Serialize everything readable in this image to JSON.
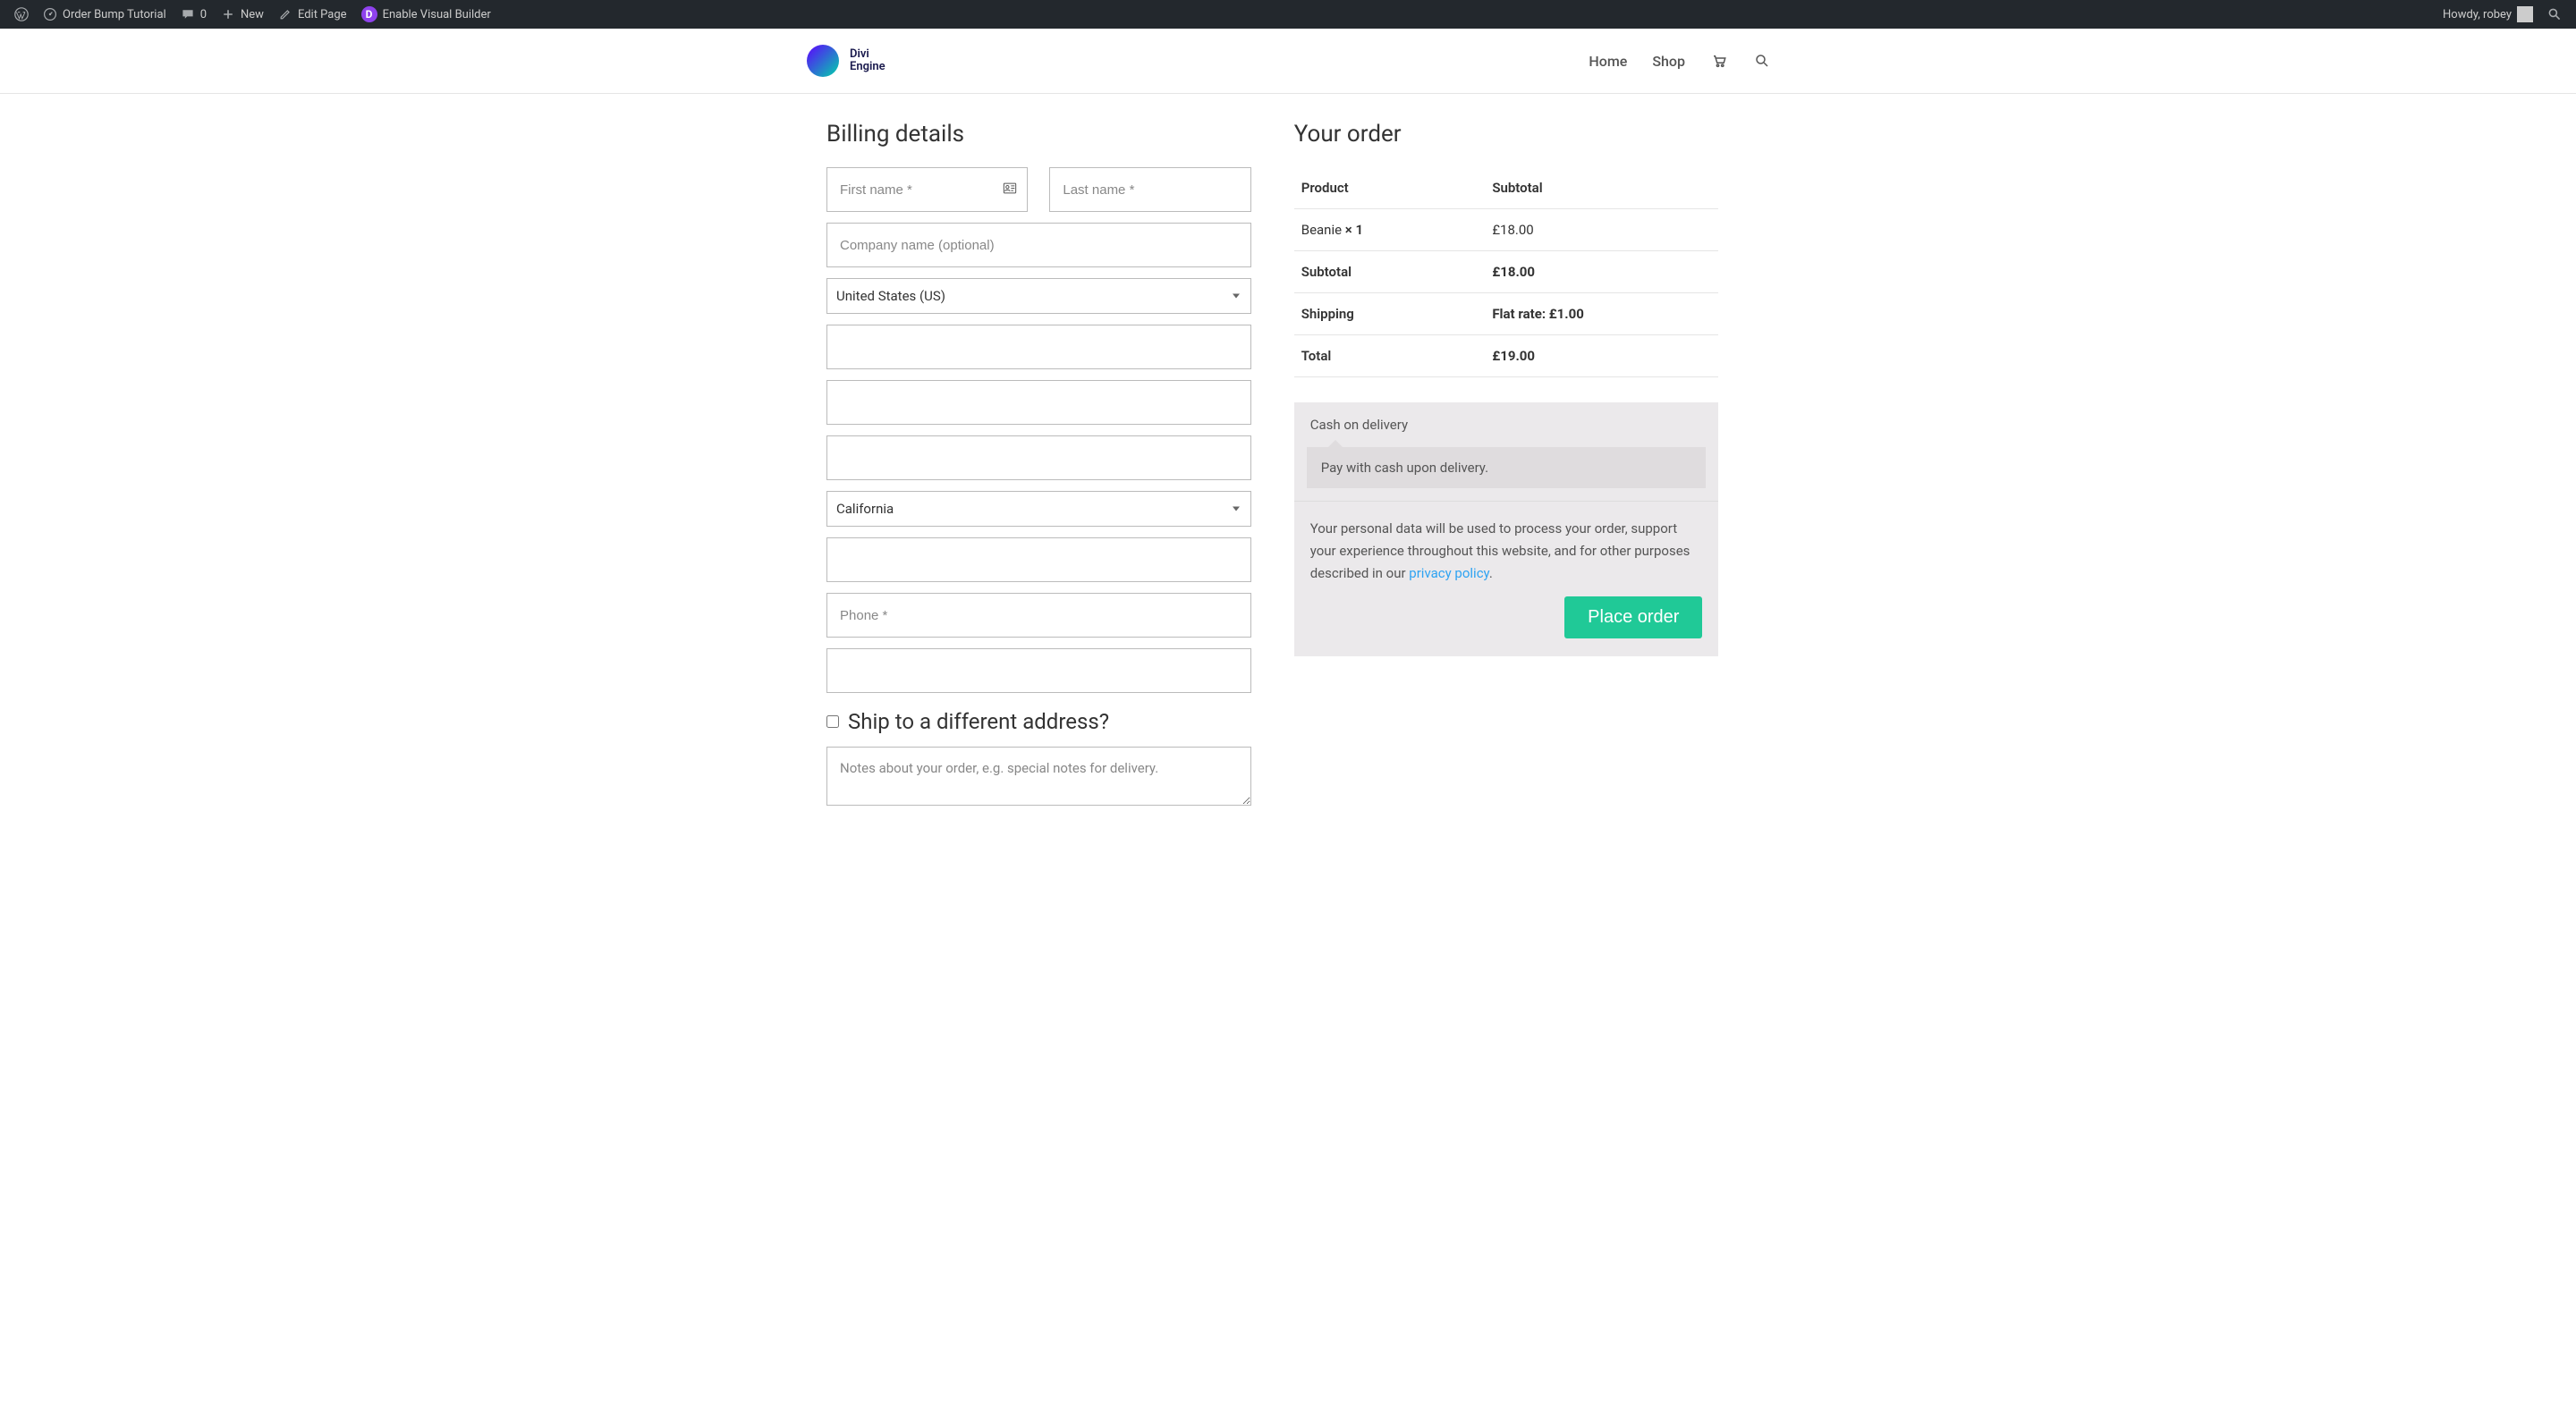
{
  "adminbar": {
    "site_title": "Order Bump Tutorial",
    "comments_count": "0",
    "new_label": "New",
    "edit_label": "Edit Page",
    "visual_builder_label": "Enable Visual Builder",
    "howdy": "Howdy, robey"
  },
  "header": {
    "logo_text_line1": "Divi",
    "logo_text_line2": "Engine",
    "nav": {
      "home": "Home",
      "shop": "Shop"
    }
  },
  "billing": {
    "title": "Billing details",
    "first_name_placeholder": "First name *",
    "last_name_placeholder": "Last name *",
    "company_placeholder": "Company name (optional)",
    "country_selected": "United States (US)",
    "state_selected": "California",
    "phone_placeholder": "Phone *",
    "ship_different_label": "Ship to a different address?",
    "notes_placeholder": "Notes about your order, e.g. special notes for delivery."
  },
  "order": {
    "title": "Your order",
    "headers": {
      "product": "Product",
      "subtotal": "Subtotal"
    },
    "item": {
      "name": "Beanie  ",
      "qty_prefix": "× ",
      "qty": "1",
      "price": "£18.00"
    },
    "subtotal_label": "Subtotal",
    "subtotal_value": "£18.00",
    "shipping_label": "Shipping",
    "shipping_value": "Flat rate: £1.00",
    "total_label": "Total",
    "total_value": "£19.00",
    "payment_method": "Cash on delivery",
    "payment_desc": "Pay with cash upon delivery.",
    "privacy_text_1": "Your personal data will be used to process your order, support your experience throughout this website, and for other purposes described in our ",
    "privacy_link": "privacy policy",
    "privacy_text_2": ".",
    "place_order": "Place order"
  }
}
